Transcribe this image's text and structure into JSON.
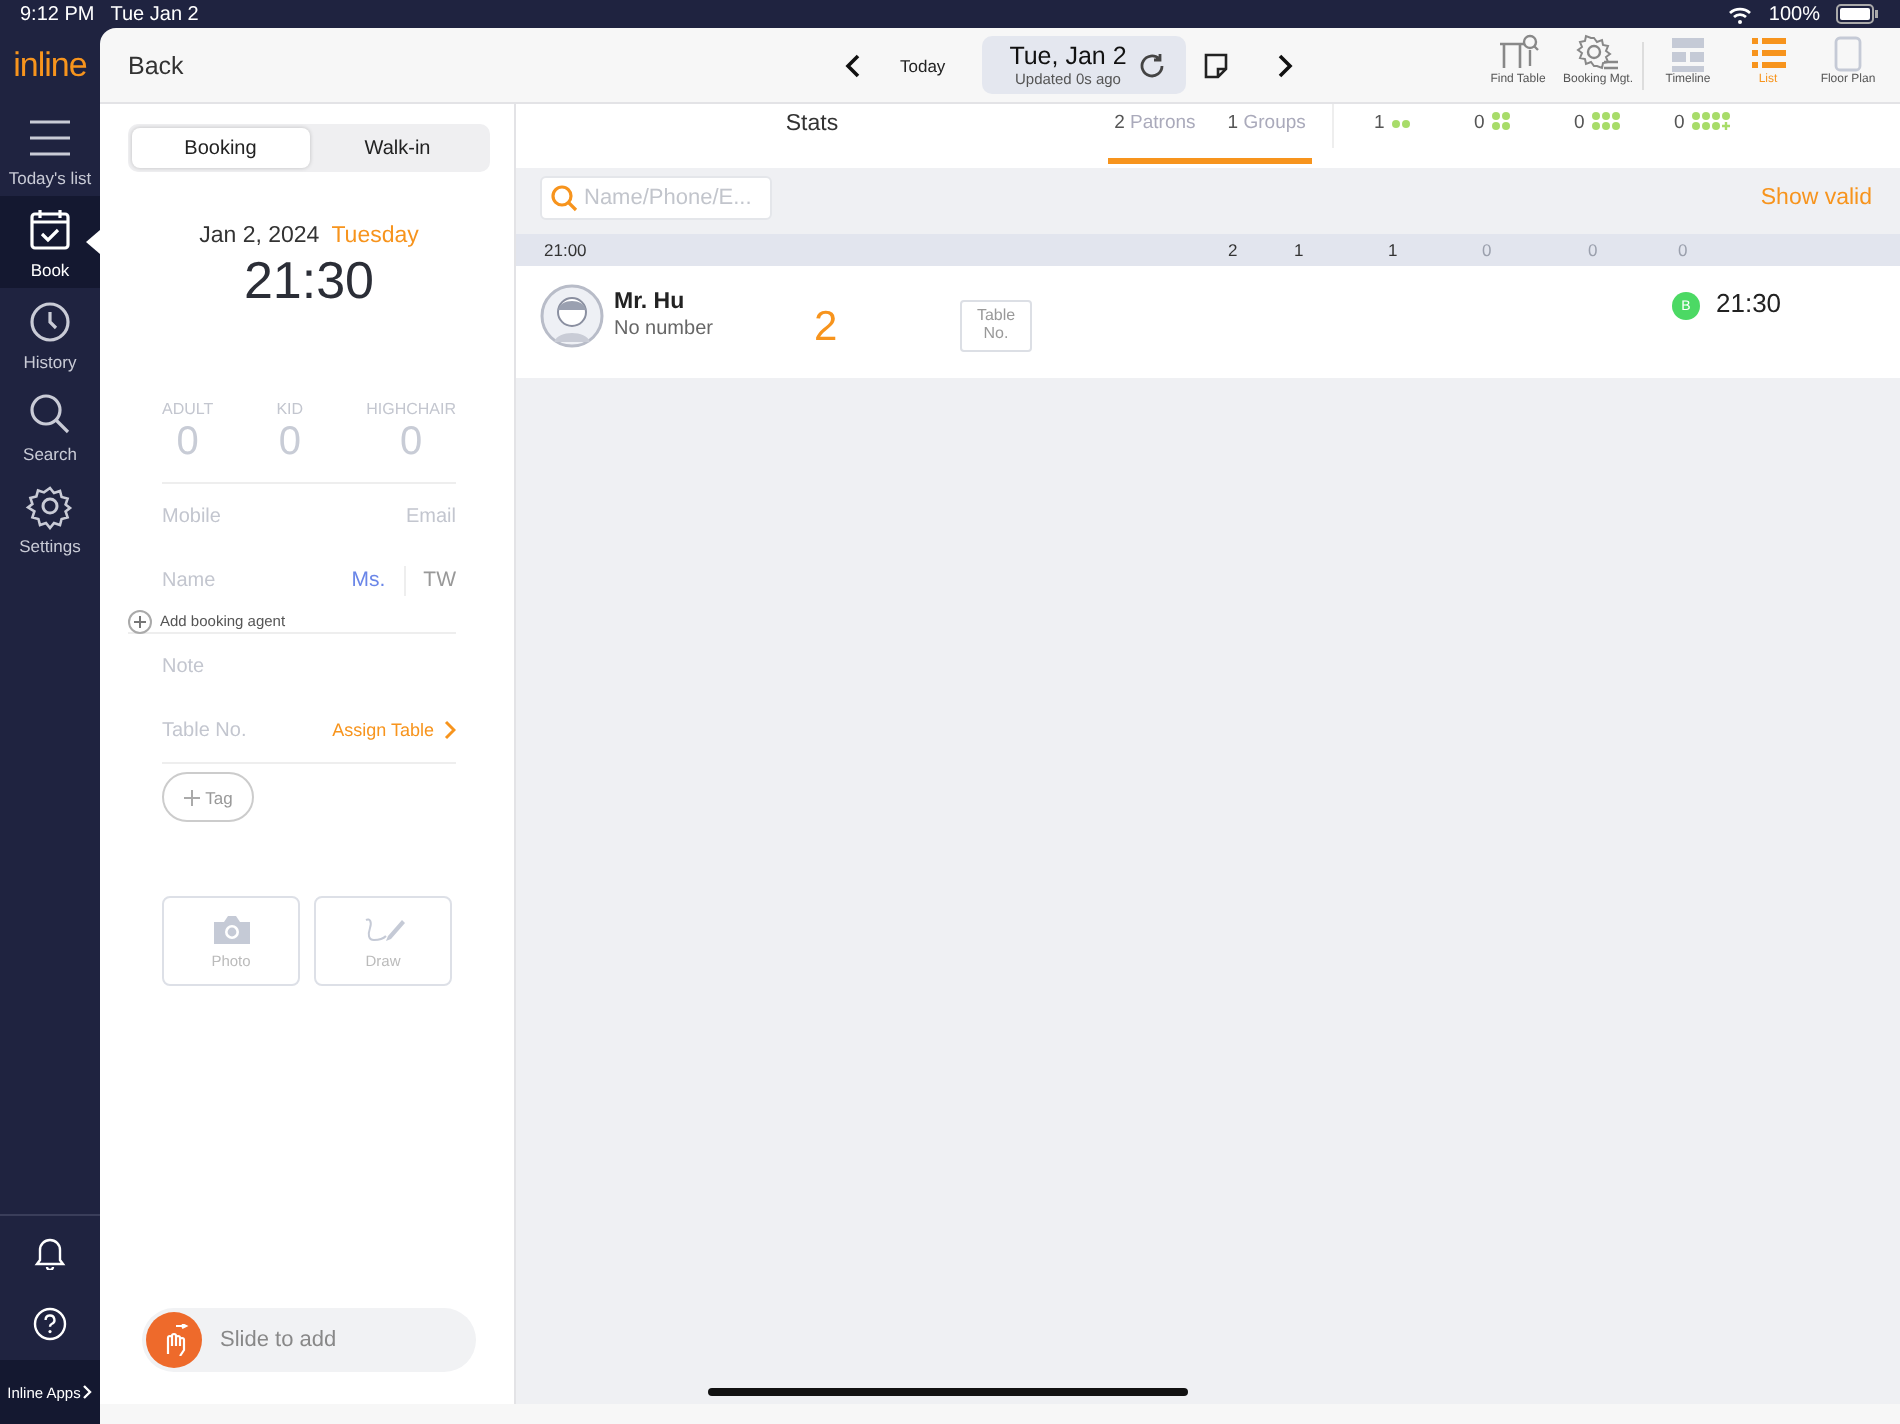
{
  "status_bar": {
    "time": "9:12 PM",
    "date": "Tue Jan 2",
    "battery": "100%"
  },
  "nav": {
    "logo": "inline",
    "items": [
      {
        "kind": "list",
        "label": "Today's list",
        "selected": false
      },
      {
        "kind": "book",
        "label": "Book",
        "selected": true
      },
      {
        "kind": "history",
        "label": "History",
        "selected": false
      },
      {
        "kind": "search",
        "label": "Search",
        "selected": false
      },
      {
        "kind": "settings",
        "label": "Settings",
        "selected": false
      }
    ],
    "apps_label": "Inline Apps"
  },
  "top_bar": {
    "back": "Back",
    "today": "Today",
    "date": "Tue, Jan 2",
    "updated": "Updated 0s ago",
    "tools": [
      {
        "kind": "find",
        "label": "Find Table",
        "selected": false
      },
      {
        "kind": "mgt",
        "label": "Booking Mgt.",
        "selected": false
      },
      {
        "kind": "timeline",
        "label": "Timeline",
        "selected": false
      },
      {
        "kind": "list",
        "label": "List",
        "selected": true
      },
      {
        "kind": "floor",
        "label": "Floor Plan",
        "selected": false
      }
    ]
  },
  "form": {
    "modes": [
      {
        "label": "Booking",
        "selected": true
      },
      {
        "label": "Walk-in",
        "selected": false
      }
    ],
    "date": "Jan 2, 2024",
    "weekday": "Tuesday",
    "time": "21:30",
    "counts": [
      {
        "label": "ADULT",
        "value": "0"
      },
      {
        "label": "KID",
        "value": "0"
      },
      {
        "label": "HIGHCHAIR",
        "value": "0"
      }
    ],
    "mobile_placeholder": "Mobile",
    "email": "Email",
    "name_placeholder": "Name",
    "title": "Ms.",
    "region": "TW",
    "agent": "Add booking agent",
    "note_placeholder": "Note",
    "table_label": "Table No.",
    "assign": "Assign Table",
    "tag": "Tag",
    "photo": "Photo",
    "draw": "Draw",
    "slider": {
      "label": "Slide to add",
      "level": 0
    }
  },
  "list": {
    "stats_title": "Stats",
    "stats_tabs": [
      {
        "count": "2",
        "label": "Patrons"
      },
      {
        "count": "1",
        "label": "Groups"
      }
    ],
    "party_sizes": [
      {
        "kind": "two",
        "count": "1"
      },
      {
        "kind": "four",
        "count": "0"
      },
      {
        "kind": "six",
        "count": "0"
      },
      {
        "kind": "eight_plus",
        "count": "0"
      }
    ],
    "search_placeholder": "Name/Phone/E...",
    "show_valid": "Show valid",
    "group": {
      "time": "21:00",
      "columns": [
        {
          "value": "2",
          "dim": false
        },
        {
          "value": "1",
          "dim": false
        },
        {
          "value": "1",
          "dim": false
        },
        {
          "value": "0",
          "dim": true
        },
        {
          "value": "0",
          "dim": true
        },
        {
          "value": "0",
          "dim": true
        }
      ]
    },
    "bookings": [
      {
        "name": "Mr. Hu",
        "phone": "No number",
        "party": "2",
        "table": "Table No.",
        "badge": "B",
        "color": "#4cd964",
        "time": "21:30"
      }
    ]
  }
}
